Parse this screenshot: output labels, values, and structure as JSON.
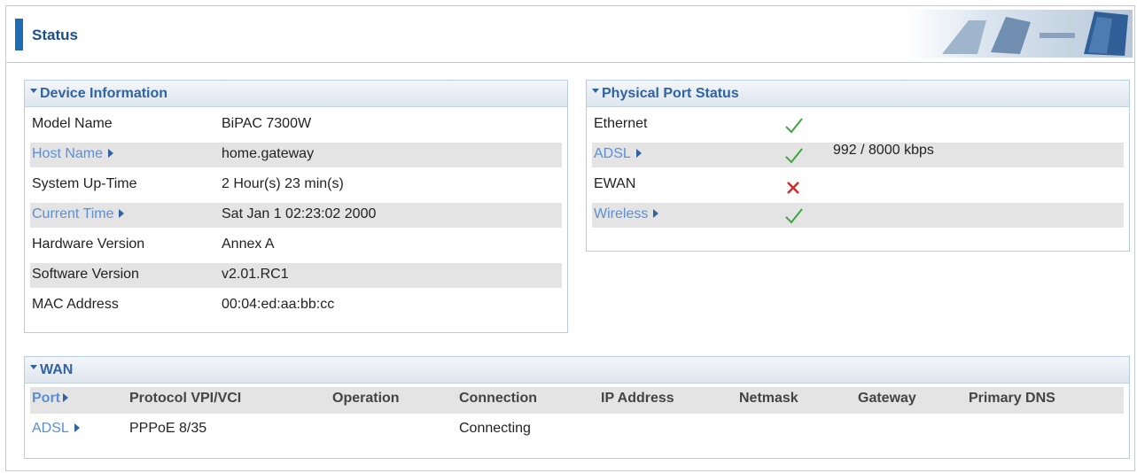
{
  "header": {
    "title": "Status"
  },
  "device_info": {
    "title": "Device Information",
    "rows": [
      {
        "label": "Model Name",
        "value": "BiPAC 7300W",
        "link": false
      },
      {
        "label": "Host Name",
        "value": "home.gateway",
        "link": true
      },
      {
        "label": "System Up-Time",
        "value": "2 Hour(s) 23 min(s)",
        "link": false
      },
      {
        "label": "Current Time",
        "value": "Sat Jan 1 02:23:02 2000",
        "link": true
      },
      {
        "label": "Hardware Version",
        "value": "Annex A",
        "link": false
      },
      {
        "label": "Software Version",
        "value": "v2.01.RC1",
        "link": false
      },
      {
        "label": "MAC Address",
        "value": "00:04:ed:aa:bb:cc",
        "link": false
      }
    ]
  },
  "port_status": {
    "title": "Physical Port Status",
    "rows": [
      {
        "label": "Ethernet",
        "status": "ok",
        "detail": "",
        "link": false
      },
      {
        "label": "ADSL",
        "status": "ok",
        "detail": "992 / 8000 kbps",
        "link": true
      },
      {
        "label": "EWAN",
        "status": "fail",
        "detail": "",
        "link": false
      },
      {
        "label": "Wireless",
        "status": "ok",
        "detail": "",
        "link": true
      }
    ]
  },
  "wan": {
    "title": "WAN",
    "columns": [
      "Port",
      "Protocol VPI/VCI",
      "Operation",
      "Connection",
      "IP Address",
      "Netmask",
      "Gateway",
      "Primary DNS"
    ],
    "rows": [
      {
        "port": "ADSL",
        "protocol": "PPPoE 8/35",
        "operation": "",
        "connection": "Connecting",
        "ip": "",
        "netmask": "",
        "gateway": "",
        "dns": ""
      }
    ]
  },
  "icons": {
    "ok": "checkmark-icon",
    "fail": "cross-icon",
    "expand": "caret-down-icon",
    "link": "triangle-right-icon"
  },
  "colors": {
    "accent": "#1f6cb5",
    "link": "#5b8fd6",
    "ok": "#3aa83a",
    "fail": "#d42a2a",
    "panel_border": "#b9cde0"
  }
}
